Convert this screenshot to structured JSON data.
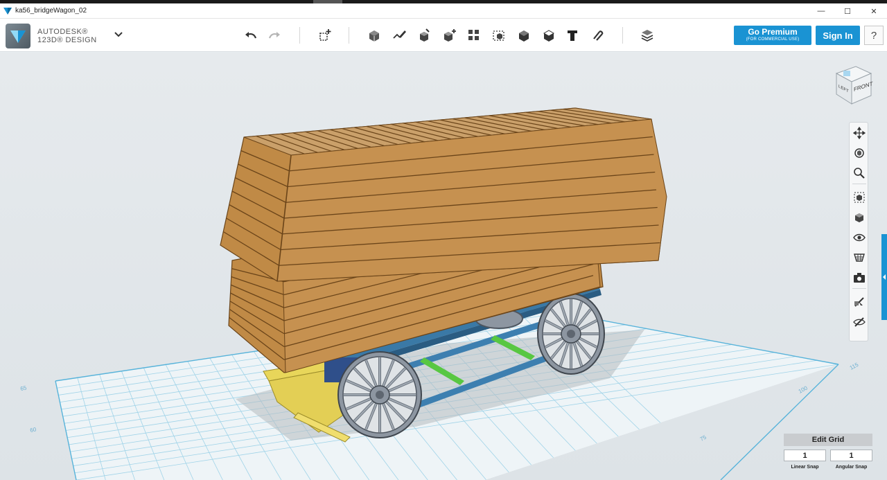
{
  "window": {
    "title": "ka56_bridgeWagon_02",
    "controls": {
      "minimize": "—",
      "maximize": "☐",
      "close": "✕"
    }
  },
  "brand": {
    "line1": "AUTODESK®",
    "line2": "123D® DESIGN",
    "menu_icon": "chevron-down-icon"
  },
  "toolbar": {
    "undo_icon": "undo-icon",
    "redo_icon": "redo-icon",
    "tools": [
      "new-primitive-icon",
      "primitives-icon",
      "sketch-icon",
      "construct-icon",
      "modify-icon",
      "pattern-icon",
      "grouping-icon",
      "combine-icon",
      "measure-icon",
      "text-icon",
      "snap-icon",
      "material-icon"
    ]
  },
  "account": {
    "premium_label": "Go Premium",
    "premium_sub": "(FOR COMMERCIAL USE)",
    "signin_label": "Sign In",
    "help_label": "?"
  },
  "viewcube": {
    "left_label": "LEFT",
    "front_label": "FRONT"
  },
  "navbar": {
    "items": [
      "pan-icon",
      "orbit-icon",
      "zoom-icon",
      "fit-icon",
      "perspective-icon",
      "visibility-icon",
      "material-view-icon",
      "camera-icon",
      "selection-icon",
      "hide-icon"
    ]
  },
  "grid": {
    "labels": [
      "65",
      "60",
      "115",
      "100",
      "75"
    ]
  },
  "grid_settings": {
    "edit_label": "Edit Grid",
    "linear_value": "1",
    "angular_value": "1",
    "linear_label": "Linear Snap",
    "angular_label": "Angular Snap"
  },
  "colors": {
    "accent": "#1a93d3",
    "wood": "#c08a46",
    "wood_dark": "#8c5e28",
    "frame_blue": "#3a79a6",
    "axle_yellow": "#e8d65a",
    "brace_green": "#58c742",
    "wheel_gray": "#8d96a1",
    "grid_line": "#7fc3df"
  }
}
